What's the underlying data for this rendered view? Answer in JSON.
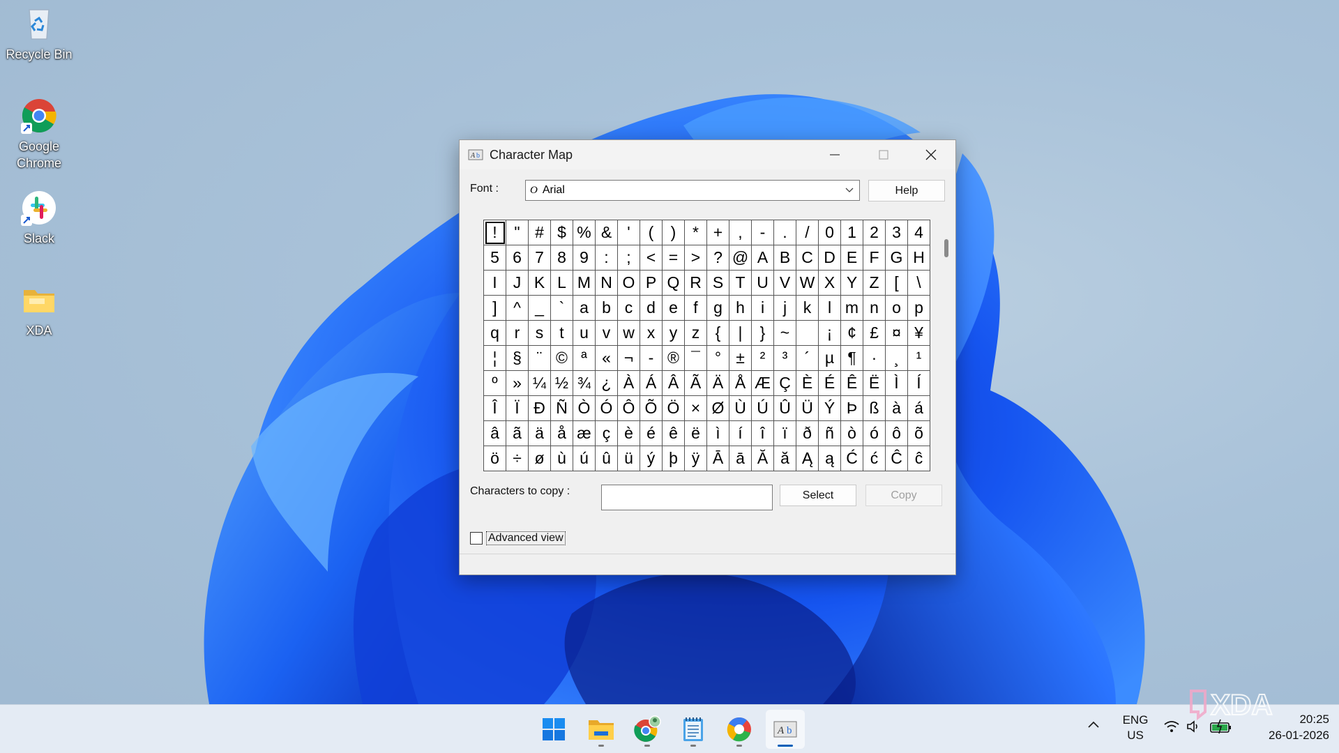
{
  "desktop": {
    "icons": [
      {
        "label": "Recycle Bin",
        "icon": "recycle-bin-icon"
      },
      {
        "label": "Google Chrome",
        "icon": "chrome-icon"
      },
      {
        "label": "Slack",
        "icon": "slack-icon"
      },
      {
        "label": "XDA",
        "icon": "folder-icon"
      }
    ]
  },
  "window": {
    "title": "Character Map",
    "font_label": "Font :",
    "font_value": "Arial",
    "font_type_glyph": "O",
    "help_label": "Help",
    "copy_label": "Characters to copy :",
    "copy_value": "",
    "select_label": "Select",
    "copy_button_label": "Copy",
    "advanced_label": "Advanced view",
    "advanced_checked": false,
    "characters": [
      "!",
      "\"",
      "#",
      "$",
      "%",
      "&",
      "'",
      "(",
      ")",
      "*",
      "+",
      ",",
      "-",
      ".",
      "/",
      "0",
      "1",
      "2",
      "3",
      "4",
      "5",
      "6",
      "7",
      "8",
      "9",
      ":",
      ";",
      "<",
      "=",
      ">",
      "?",
      "@",
      "A",
      "B",
      "C",
      "D",
      "E",
      "F",
      "G",
      "H",
      "I",
      "J",
      "K",
      "L",
      "M",
      "N",
      "O",
      "P",
      "Q",
      "R",
      "S",
      "T",
      "U",
      "V",
      "W",
      "X",
      "Y",
      "Z",
      "[",
      "\\",
      "]",
      "^",
      "_",
      "`",
      "a",
      "b",
      "c",
      "d",
      "e",
      "f",
      "g",
      "h",
      "i",
      "j",
      "k",
      "l",
      "m",
      "n",
      "o",
      "p",
      "q",
      "r",
      "s",
      "t",
      "u",
      "v",
      "w",
      "x",
      "y",
      "z",
      "{",
      "|",
      "}",
      "~",
      " ",
      "¡",
      "¢",
      "£",
      "¤",
      "¥",
      "¦",
      "§",
      "¨",
      "©",
      "ª",
      "«",
      "¬",
      "-",
      "®",
      "¯",
      "°",
      "±",
      "²",
      "³",
      "´",
      "µ",
      "¶",
      "·",
      "¸",
      "¹",
      "º",
      "»",
      "¼",
      "½",
      "¾",
      "¿",
      "À",
      "Á",
      "Â",
      "Ã",
      "Ä",
      "Å",
      "Æ",
      "Ç",
      "È",
      "É",
      "Ê",
      "Ë",
      "Ì",
      "Í",
      "Î",
      "Ï",
      "Ð",
      "Ñ",
      "Ò",
      "Ó",
      "Ô",
      "Õ",
      "Ö",
      "×",
      "Ø",
      "Ù",
      "Ú",
      "Û",
      "Ü",
      "Ý",
      "Þ",
      "ß",
      "à",
      "á",
      "â",
      "ã",
      "ä",
      "å",
      "æ",
      "ç",
      "è",
      "é",
      "ê",
      "ë",
      "ì",
      "í",
      "î",
      "ï",
      "ð",
      "ñ",
      "ò",
      "ó",
      "ô",
      "õ",
      "ö",
      "÷",
      "ø",
      "ù",
      "ú",
      "û",
      "ü",
      "ý",
      "þ",
      "ÿ",
      "Ā",
      "ā",
      "Ă",
      "ă",
      "Ą",
      "ą",
      "Ć",
      "ć",
      "Ĉ",
      "ĉ"
    ],
    "selected_index": 0
  },
  "taskbar": {
    "apps": [
      {
        "name": "start",
        "icon": "windows-start-icon",
        "running": false,
        "active": false
      },
      {
        "name": "file-explorer",
        "icon": "file-explorer-icon",
        "running": true,
        "active": false
      },
      {
        "name": "chrome",
        "icon": "chrome-icon",
        "running": true,
        "active": false
      },
      {
        "name": "notepad",
        "icon": "notepad-icon",
        "running": true,
        "active": false
      },
      {
        "name": "edge-canary",
        "icon": "browser-icon",
        "running": true,
        "active": false
      },
      {
        "name": "character-map",
        "icon": "character-map-icon",
        "running": true,
        "active": true
      }
    ],
    "language": {
      "line1": "ENG",
      "line2": "US"
    },
    "time": "20:25",
    "date": "26-01-2026"
  },
  "watermark": "XDA",
  "colors": {
    "taskbar_bg": "#e4ebf4",
    "window_bg": "#f0f0f0",
    "accent": "#005fb8",
    "bloom": "#1a5bf0"
  }
}
